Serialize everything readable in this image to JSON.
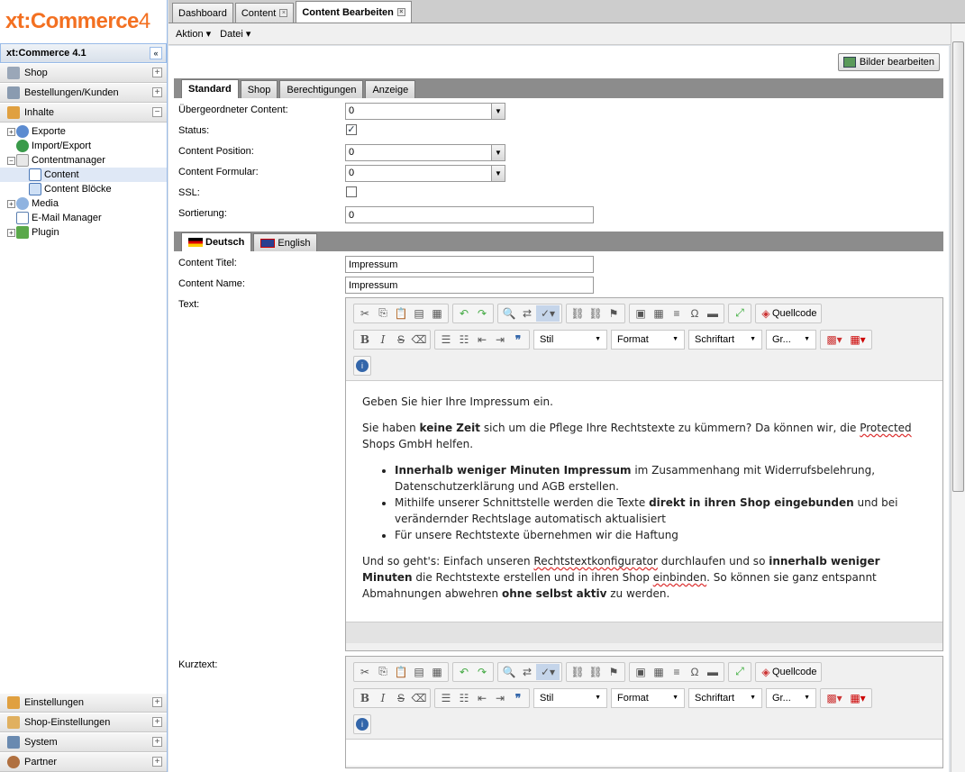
{
  "app": {
    "logo": "xt:Commerce",
    "logo_num": "4",
    "version": "xt:Commerce 4.1"
  },
  "sidebar": {
    "acc_top": [
      {
        "label": "Shop"
      },
      {
        "label": "Bestellungen/Kunden"
      },
      {
        "label": "Inhalte"
      }
    ],
    "tree": [
      {
        "label": "Exporte"
      },
      {
        "label": "Import/Export"
      },
      {
        "label": "Contentmanager"
      },
      {
        "label": "Content"
      },
      {
        "label": "Content Blöcke"
      },
      {
        "label": "Media"
      },
      {
        "label": "E-Mail Manager"
      },
      {
        "label": "Plugin"
      }
    ],
    "acc_bottom": [
      {
        "label": "Einstellungen"
      },
      {
        "label": "Shop-Einstellungen"
      },
      {
        "label": "System"
      },
      {
        "label": "Partner"
      }
    ]
  },
  "tabs": [
    {
      "label": "Dashboard"
    },
    {
      "label": "Content"
    },
    {
      "label": "Content Bearbeiten"
    }
  ],
  "menu": {
    "aktion": "Aktion ▾",
    "datei": "Datei ▾"
  },
  "bilder_button": "Bilder bearbeiten",
  "panel_tabs": [
    {
      "label": "Standard"
    },
    {
      "label": "Shop"
    },
    {
      "label": "Berechtigungen"
    },
    {
      "label": "Anzeige"
    }
  ],
  "form": {
    "parent_label": "Übergeordneter Content:",
    "parent_value": "0",
    "status_label": "Status:",
    "position_label": "Content Position:",
    "position_value": "0",
    "formular_label": "Content Formular:",
    "formular_value": "0",
    "ssl_label": "SSL:",
    "sort_label": "Sortierung:",
    "sort_value": "0"
  },
  "lang_tabs": [
    {
      "label": "Deutsch"
    },
    {
      "label": "English"
    }
  ],
  "lang_form": {
    "titel_label": "Content Titel:",
    "titel_value": "Impressum",
    "name_label": "Content Name:",
    "name_value": "Impressum",
    "text_label": "Text:",
    "kurz_label": "Kurztext:"
  },
  "editor": {
    "quellcode": "Quellcode",
    "stil": "Stil",
    "format": "Format",
    "schriftart": "Schriftart",
    "groesse": "Gr..."
  },
  "text_content": {
    "p1": "Geben Sie hier Ihre Impressum ein.",
    "p2a": "Sie haben ",
    "p2b": "keine Zeit",
    "p2c": " sich um die Pflege Ihre Rechtstexte zu kümmern? Da können wir, die ",
    "p2d": "Protected",
    "p2e": " Shops GmbH helfen.",
    "li1a": "Innerhalb weniger Minuten Impressum",
    "li1b": " im Zusammenhang mit Widerrufsbelehrung, Datenschutzerklärung und AGB erstellen.",
    "li2a": "Mithilfe unserer Schnittstelle werden die Texte ",
    "li2b": "direkt in ihren Shop eingebunden",
    "li2c": " und bei verändernder Rechtslage automatisch aktualisiert",
    "li3": "Für unsere Rechtstexte übernehmen wir die Haftung",
    "p3a": "Und so geht's: Einfach unseren ",
    "p3b": "Rechtstextkonfigurator",
    "p3c": " durchlaufen und so ",
    "p3d": "innerhalb weniger Minuten",
    "p3e": " die Rechtstexte erstellen und in ihren Shop ",
    "p3f": "einbinden",
    "p3g": ". So können sie ganz entspannt Abmahnungen abwehren ",
    "p3h": "ohne selbst aktiv",
    "p3i": " zu werden."
  }
}
